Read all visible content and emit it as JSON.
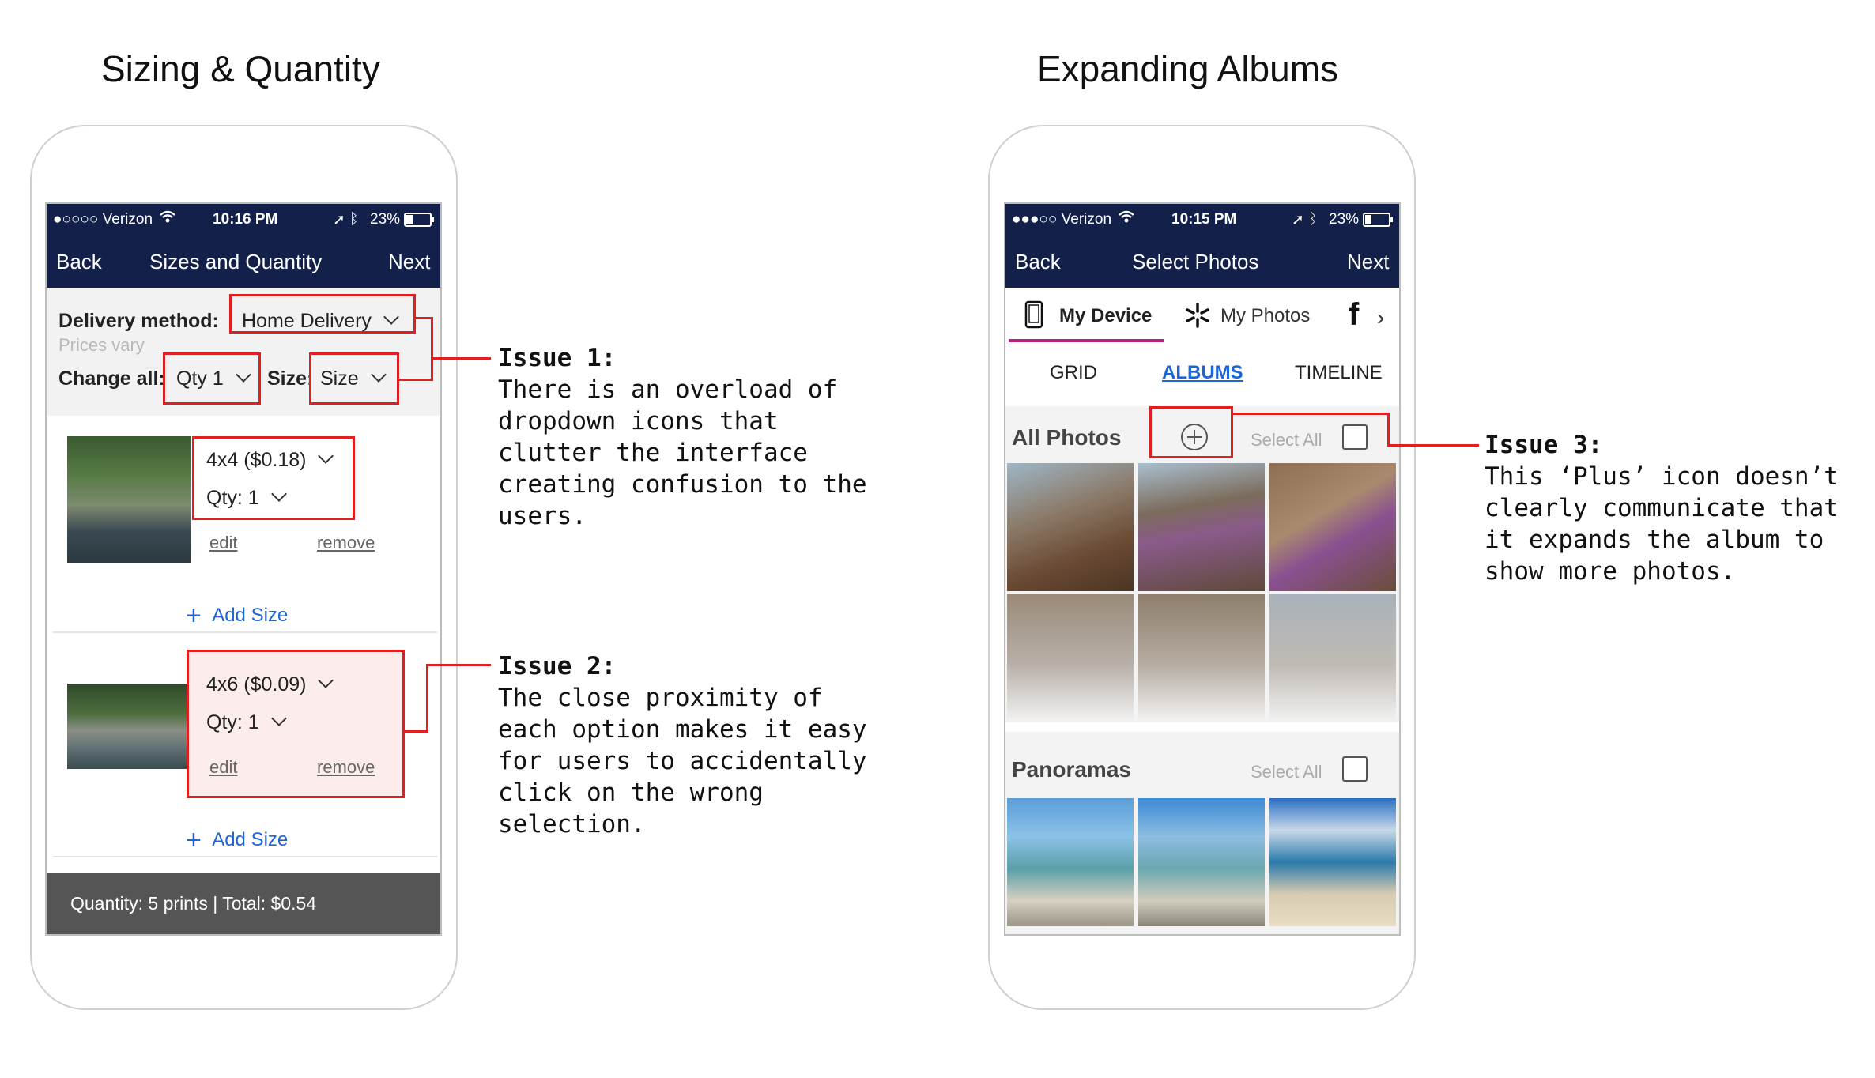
{
  "headings": {
    "left": "Sizing & Quantity",
    "right": "Expanding Albums"
  },
  "left_phone": {
    "status": {
      "carrier": "●○○○○ Verizon",
      "time": "10:16 PM",
      "battery": "23%"
    },
    "nav": {
      "back": "Back",
      "title": "Sizes and Quantity",
      "next": "Next"
    },
    "delivery_label": "Delivery method:",
    "delivery_value": "Home Delivery",
    "prices_note": "Prices vary",
    "change_all_label": "Change all:",
    "qty_all": "Qty 1",
    "size_label": "Size:",
    "size_value": "Size",
    "items": [
      {
        "size": "4x4 ($0.18)",
        "qty": "Qty: 1",
        "edit": "edit",
        "remove": "remove",
        "add": "Add Size"
      },
      {
        "size": "4x6 ($0.09)",
        "qty": "Qty: 1",
        "edit": "edit",
        "remove": "remove",
        "add": "Add Size"
      }
    ],
    "footer": "Quantity: 5 prints | Total: $0.54"
  },
  "right_phone": {
    "status": {
      "carrier": "●●●○○ Verizon",
      "time": "10:15 PM",
      "battery": "23%"
    },
    "nav": {
      "back": "Back",
      "title": "Select Photos",
      "next": "Next"
    },
    "sources": {
      "device": "My Device",
      "photos": "My Photos"
    },
    "views": {
      "grid": "GRID",
      "albums": "ALBUMS",
      "timeline": "TIMELINE"
    },
    "albums": [
      {
        "name": "All Photos",
        "select_all": "Select All"
      },
      {
        "name": "Panoramas",
        "select_all": "Select All"
      }
    ]
  },
  "issues": [
    {
      "title": "Issue 1:",
      "body": "There is an overload of\ndropdown icons that\nclutter the interface\ncreating confusion to the\nusers."
    },
    {
      "title": "Issue 2:",
      "body": "The close proximity of\neach option makes it easy\nfor users to accidentally\nclick on the wrong\nselection."
    },
    {
      "title": "Issue 3:",
      "body": "This ‘Plus’ icon doesn’t\nclearly communicate that\nit expands the album to\nshow more photos."
    }
  ],
  "colors": {
    "navbar": "#13214a",
    "highlight": "#e02020",
    "link": "#1e63d8",
    "footer": "#555555"
  },
  "icons": [
    "wifi-icon",
    "location-icon",
    "bluetooth-icon",
    "battery-icon",
    "chevron-down-icon",
    "plus-icon",
    "phone-device-icon",
    "walmart-spark-icon",
    "facebook-icon",
    "chevron-right-icon",
    "plus-circle-icon"
  ]
}
